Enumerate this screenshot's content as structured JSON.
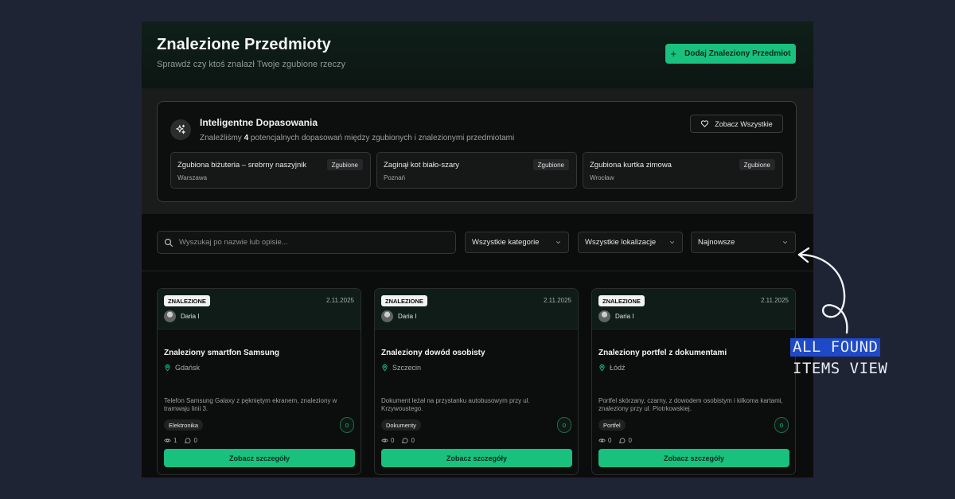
{
  "header": {
    "title": "Znalezione Przedmioty",
    "subtitle": "Sprawdź czy ktoś znalazł Twoje zgubione rzeczy",
    "add_button_label": "Dodaj Znaleziony Przedmiot",
    "add_button_icon": "plus-icon"
  },
  "matches": {
    "icon": "sparkles-icon",
    "title": "Inteligentne Dopasowania",
    "desc_before": "Znaleźliśmy",
    "count": "4",
    "desc_after": "potencjalnych dopasowań między zgubionych i znalezionymi przedmiotami",
    "see_all_label": "Zobacz Wszystkie",
    "see_all_icon": "heart-icon",
    "items": [
      {
        "title": "Zgubiona biżuteria – srebrny naszyjnik",
        "city": "Warszawa",
        "badge": "Zgubione"
      },
      {
        "title": "Zaginął kot biało-szary",
        "city": "Poznań",
        "badge": "Zgubione"
      },
      {
        "title": "Zgubiona kurtka zimowa",
        "city": "Wrocław",
        "badge": "Zgubione"
      }
    ]
  },
  "filters": {
    "search_placeholder": "Wyszukaj po nazwie lub opisie...",
    "category": "Wszystkie kategorie",
    "location": "Wszystkie lokalizacje",
    "sort": "Najnowsze"
  },
  "cards": [
    {
      "status": "ZNALEZIONE",
      "date": "2.11.2025",
      "author": "Daria I",
      "title": "Znaleziony smartfon Samsung",
      "location": "Gdańsk",
      "description": "Telefon Samsung Galaxy z pękniętym ekranem, znaleziony w tramwaju linii 3.",
      "category": "Elektronika",
      "matches": "0",
      "views": "1",
      "comments": "0",
      "button_label": "Zobacz szczegóły"
    },
    {
      "status": "ZNALEZIONE",
      "date": "2.11.2025",
      "author": "Daria I",
      "title": "Znaleziony dowód osobisty",
      "location": "Szczecin",
      "description": "Dokument leżał na przystanku autobusowym przy ul. Krzywoustego.",
      "category": "Dokumenty",
      "matches": "0",
      "views": "0",
      "comments": "0",
      "button_label": "Zobacz szczegóły"
    },
    {
      "status": "ZNALEZIONE",
      "date": "2.11.2025",
      "author": "Daria I",
      "title": "Znaleziony portfel z dokumentami",
      "location": "Łódź",
      "description": "Portfel skórzany, czarny, z dowodem osobistym i kilkoma kartami, znaleziony przy ul. Piotrkowskiej.",
      "category": "Portfel",
      "matches": "0",
      "views": "0",
      "comments": "0",
      "button_label": "Zobacz szczegóły"
    }
  ],
  "annotation": {
    "line1": "ALL FOUND",
    "line2": "ITEMS VIEW"
  },
  "colors": {
    "accent": "#19c07e",
    "background": "#1f2434",
    "annotation_highlight": "#1e49c7"
  }
}
